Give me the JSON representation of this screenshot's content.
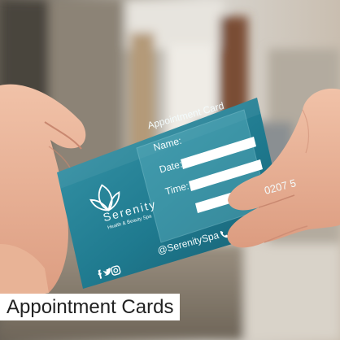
{
  "caption": "Appointment Cards",
  "card": {
    "heading": "Appointment Card",
    "fields": [
      "Name:",
      "Date:",
      "Time:"
    ],
    "brand_name": "Serenity",
    "brand_tagline": "Health & Beauty Spa",
    "phone": "0207 5",
    "social_handle": "@SerenitySpa"
  },
  "colors": {
    "card_teal": "#1d6f84",
    "card_teal_light": "#3a98ab",
    "caption_background": "#ffffff",
    "caption_text": "#222222"
  },
  "icons": [
    "lotus-logo-icon",
    "phone-icon",
    "facebook-icon",
    "twitter-icon",
    "instagram-icon"
  ]
}
